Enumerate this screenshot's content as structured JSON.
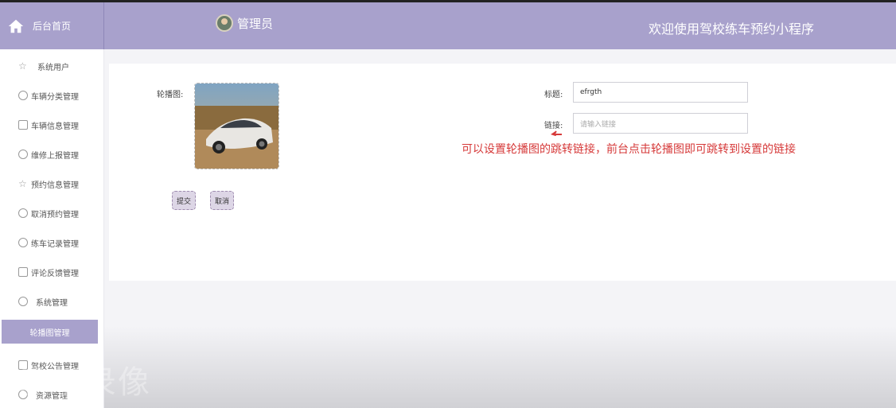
{
  "header": {
    "home_label": "后台首页",
    "admin_name": "管理员",
    "welcome_text": "欢迎使用驾校练车预约小程序"
  },
  "sidebar": {
    "items": [
      {
        "label": "系统用户",
        "icon": "star-icon"
      },
      {
        "label": "车辆分类管理",
        "icon": "clock-icon"
      },
      {
        "label": "车辆信息管理",
        "icon": "box-icon"
      },
      {
        "label": "维修上报管理",
        "icon": "moon-icon"
      },
      {
        "label": "预约信息管理",
        "icon": "star-icon"
      },
      {
        "label": "取消预约管理",
        "icon": "circle-icon"
      },
      {
        "label": "练车记录管理",
        "icon": "clock-icon"
      },
      {
        "label": "评论反馈管理",
        "icon": "check-icon"
      },
      {
        "label": "系统管理",
        "icon": "gear-icon"
      },
      {
        "label": "轮播图管理",
        "icon": "",
        "active": true
      },
      {
        "label": "驾校公告管理",
        "icon": "check-icon"
      },
      {
        "label": "资源管理",
        "icon": "moon-icon"
      }
    ]
  },
  "form": {
    "image_label": "轮播图:",
    "title_label": "标题:",
    "title_value": "efrgth",
    "link_label": "链接:",
    "link_placeholder": "请输入链接",
    "submit_label": "提交",
    "cancel_label": "取消"
  },
  "annotation": {
    "note": "可以设置轮播图的跳转链接，前台点击轮播图即可跳转到设置的链接",
    "color": "#d63a3a"
  },
  "watermark": "演示录像",
  "colors": {
    "accent": "#a8a1cc",
    "button_bg": "#ddd6e6"
  }
}
